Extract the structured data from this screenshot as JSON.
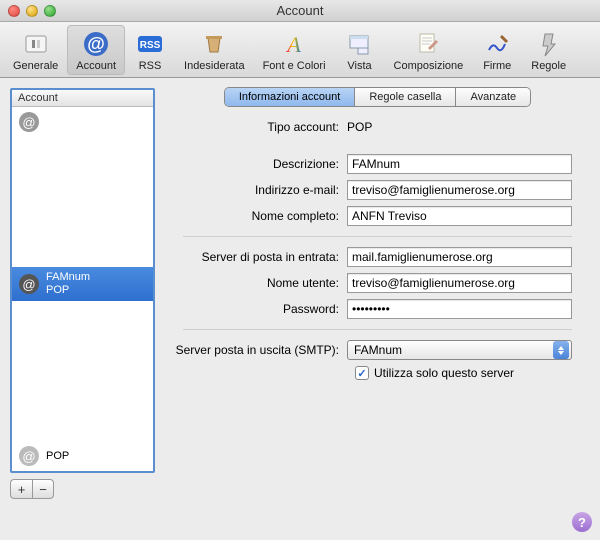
{
  "window": {
    "title": "Account"
  },
  "toolbar": {
    "items": [
      {
        "label": "Generale"
      },
      {
        "label": "Account"
      },
      {
        "label": "RSS"
      },
      {
        "label": "Indesiderata"
      },
      {
        "label": "Font e Colori"
      },
      {
        "label": "Vista"
      },
      {
        "label": "Composizione"
      },
      {
        "label": "Firme"
      },
      {
        "label": "Regole"
      }
    ]
  },
  "sidebar": {
    "header": "Account",
    "items": [
      {
        "name": "",
        "sub": ""
      },
      {
        "name": "FAMnum",
        "sub": "POP"
      },
      {
        "name": "",
        "sub": ""
      },
      {
        "name": "",
        "sub": ""
      },
      {
        "name": "",
        "sub": "POP"
      }
    ]
  },
  "tabs": [
    {
      "label": "Informazioni account"
    },
    {
      "label": "Regole casella"
    },
    {
      "label": "Avanzate"
    }
  ],
  "form": {
    "tipo_label": "Tipo account:",
    "tipo_value": "POP",
    "descrizione_label": "Descrizione:",
    "descrizione_value": "FAMnum",
    "email_label": "Indirizzo e-mail:",
    "email_value": "treviso@famiglienumerose.org",
    "nome_label": "Nome completo:",
    "nome_value": "ANFN Treviso",
    "server_in_label": "Server di posta in entrata:",
    "server_in_value": "mail.famiglienumerose.org",
    "utente_label": "Nome utente:",
    "utente_value": "treviso@famiglienumerose.org",
    "password_label": "Password:",
    "password_value": "•••••••••",
    "smtp_label": "Server posta in uscita (SMTP):",
    "smtp_value": "FAMnum",
    "checkbox_label": "Utilizza solo questo server"
  }
}
